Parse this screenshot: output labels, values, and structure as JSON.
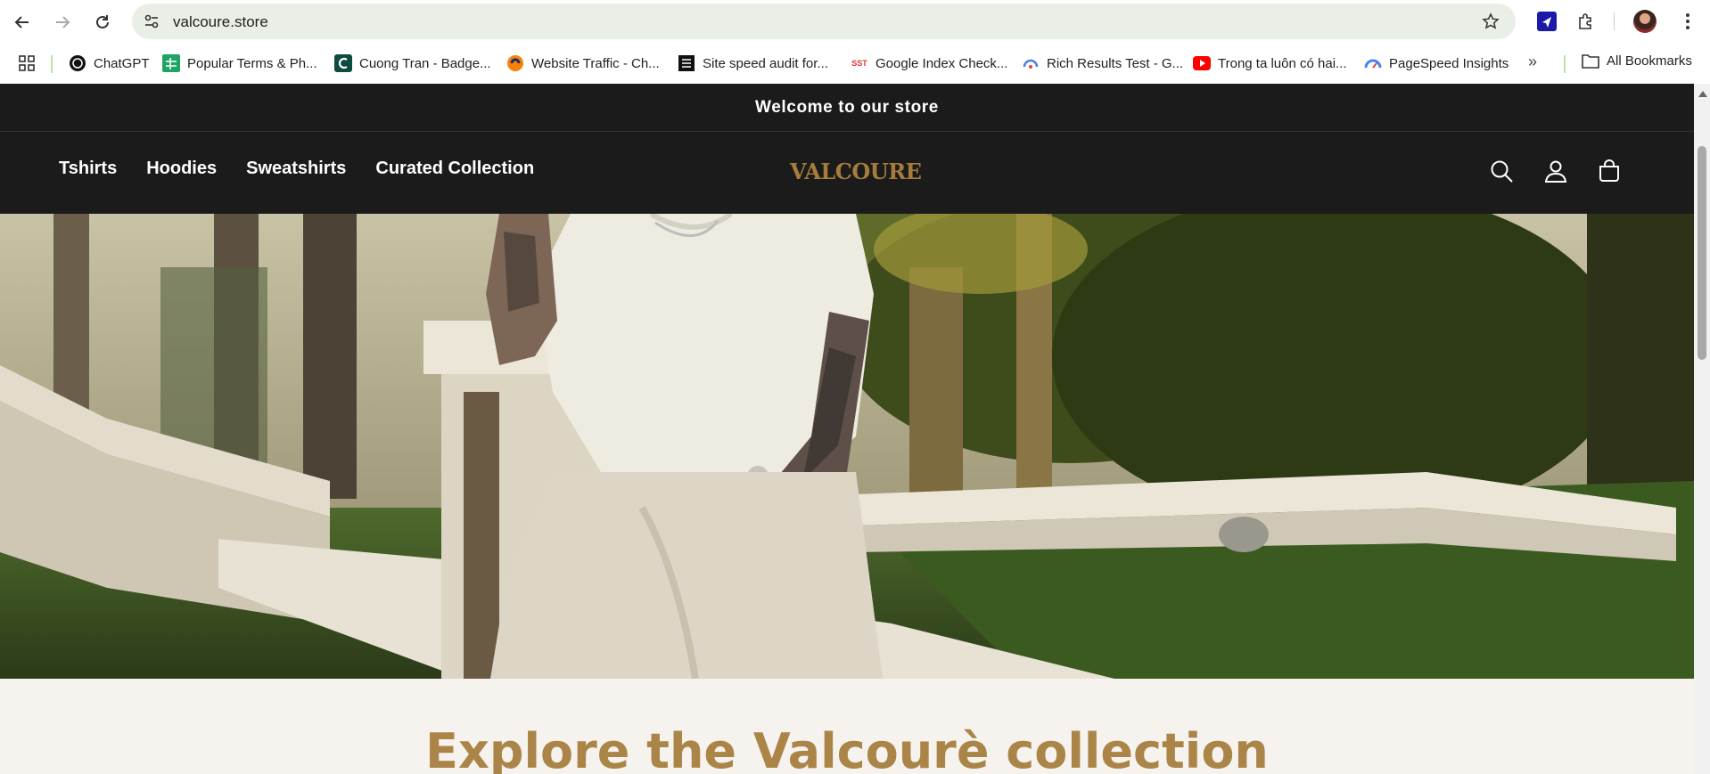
{
  "browser": {
    "url": "valcoure.store",
    "bookmarks": [
      {
        "label": "ChatGPT",
        "icon": "chatgpt-icon"
      },
      {
        "label": "Popular Terms & Ph...",
        "icon": "sheets-icon"
      },
      {
        "label": "Cuong Tran - Badge...",
        "icon": "c-logo-icon"
      },
      {
        "label": "Website Traffic - Ch...",
        "icon": "similarweb-icon"
      },
      {
        "label": "Site speed audit for...",
        "icon": "document-icon"
      },
      {
        "label": "Google Index Check...",
        "icon": "sst-icon"
      },
      {
        "label": "Rich Results Test - G...",
        "icon": "rich-results-icon"
      },
      {
        "label": "Trong ta luôn có hai...",
        "icon": "youtube-icon"
      },
      {
        "label": "PageSpeed Insights",
        "icon": "pagespeed-icon"
      }
    ],
    "all_bookmarks_label": "All Bookmarks",
    "bookmark_icon_sst_text": "SST"
  },
  "store": {
    "announcement": "Welcome to our store",
    "menu": [
      "Tshirts",
      "Hoodies",
      "Sweatshirts",
      "Curated Collection"
    ],
    "logo_text": "VALCOURE",
    "collection_heading": "Explore the Valcourè collection"
  },
  "colors": {
    "header_bg": "#1b1b1b",
    "logo_gold": "#a67c3d",
    "heading_gold": "#ab8448",
    "page_bg": "#f6f3ef",
    "omnibox_bg": "#e9efe6"
  }
}
